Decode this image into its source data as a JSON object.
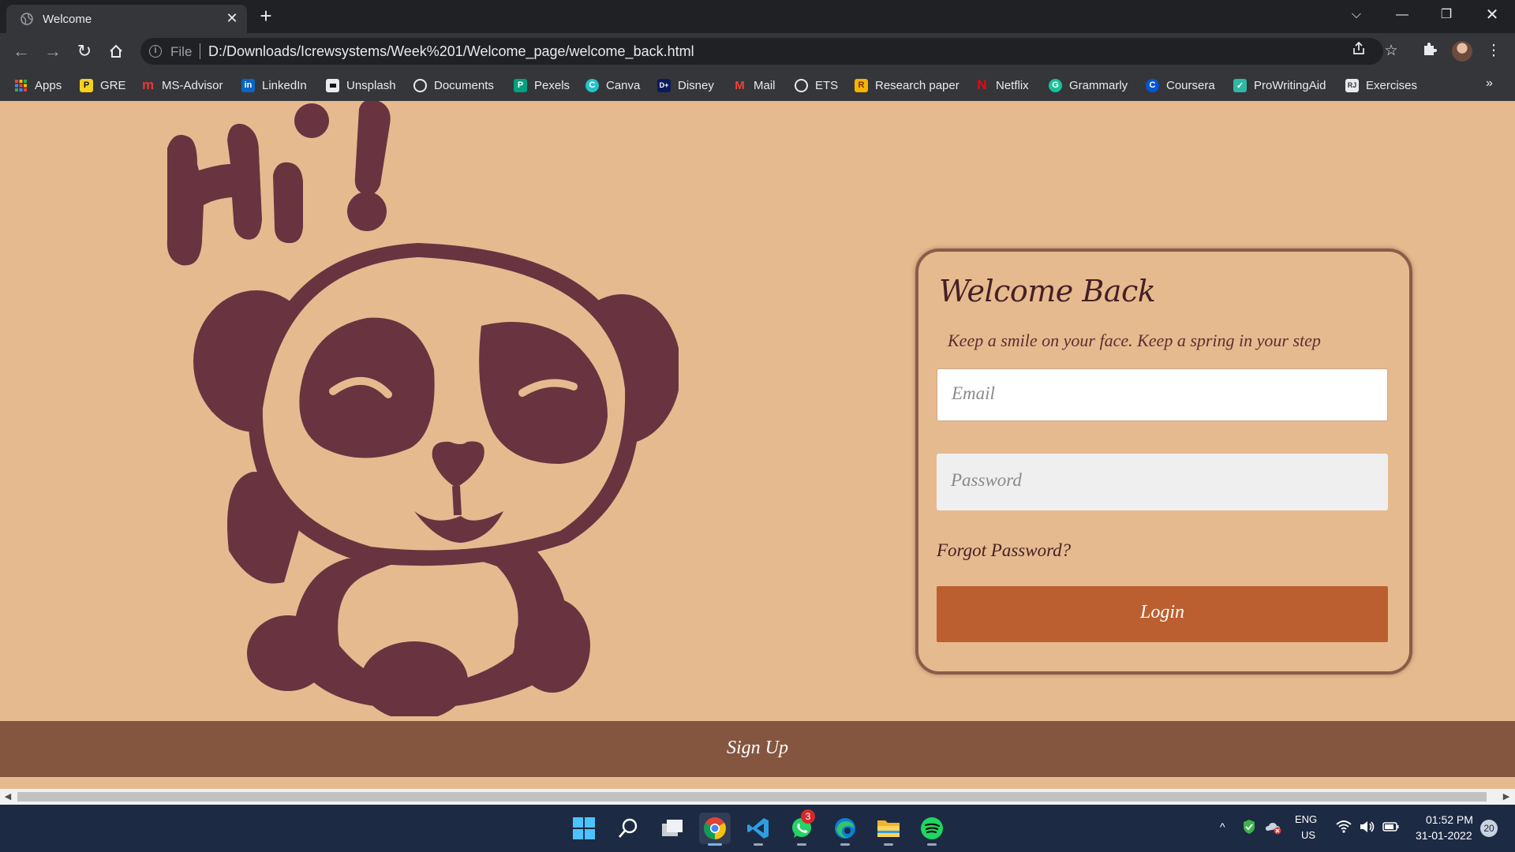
{
  "browser": {
    "tab_title": "Welcome",
    "url_scheme": "File",
    "url": "D:/Downloads/Icrewsystems/Week%201/Welcome_page/welcome_back.html"
  },
  "bookmarks": [
    {
      "label": "Apps",
      "icon": "apps-grid-icon"
    },
    {
      "label": "GRE",
      "icon": "gre-icon"
    },
    {
      "label": "MS-Advisor",
      "icon": "ms-advisor-icon"
    },
    {
      "label": "LinkedIn",
      "icon": "linkedin-icon"
    },
    {
      "label": "Unsplash",
      "icon": "unsplash-icon"
    },
    {
      "label": "Documents",
      "icon": "globe-icon"
    },
    {
      "label": "Pexels",
      "icon": "pexels-icon"
    },
    {
      "label": "Canva",
      "icon": "canva-icon"
    },
    {
      "label": "Disney",
      "icon": "disney-icon"
    },
    {
      "label": "Mail",
      "icon": "gmail-icon"
    },
    {
      "label": "ETS",
      "icon": "globe-icon"
    },
    {
      "label": "Research paper",
      "icon": "research-icon"
    },
    {
      "label": "Netflix",
      "icon": "netflix-icon"
    },
    {
      "label": "Grammarly",
      "icon": "grammarly-icon"
    },
    {
      "label": "Coursera",
      "icon": "coursera-icon"
    },
    {
      "label": "ProWritingAid",
      "icon": "prowritingaid-icon"
    },
    {
      "label": "Exercises",
      "icon": "exercises-icon"
    }
  ],
  "page": {
    "card_title": "Welcome Back",
    "card_subtitle": "Keep a smile on your face. Keep a spring in your step",
    "email_placeholder": "Email",
    "password_placeholder": "Password",
    "forgot_label": "Forgot Password?",
    "login_label": "Login",
    "signup_label": "Sign Up",
    "greeting_art_text": "Hi!"
  },
  "colors": {
    "page_bg": "#e6ba8f",
    "panda": "#6a3340",
    "login_button": "#bc5f30",
    "signup_bar": "#845640"
  },
  "taskbar": {
    "whatsapp_badge": "3",
    "language": "ENG",
    "region": "US",
    "time": "01:52 PM",
    "date": "31-01-2022",
    "notifications": "20"
  }
}
